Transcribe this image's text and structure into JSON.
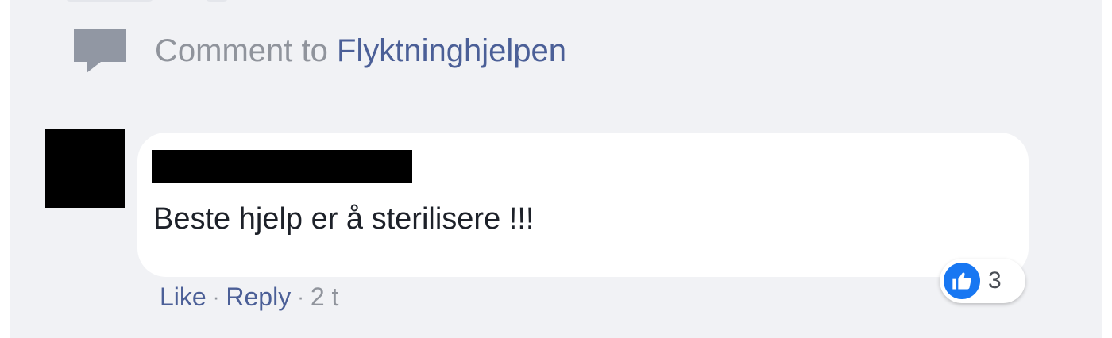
{
  "composer": {
    "prefix": "Comment to ",
    "page_name": "Flyktninghjelpen"
  },
  "comment": {
    "text": "Beste hjelp er å sterilisere !!!",
    "actions": {
      "like_label": "Like",
      "separator": "·",
      "reply_label": "Reply",
      "timestamp": "2 t"
    },
    "reactions": {
      "count": "3",
      "type_icon": "thumbs-up-icon"
    }
  },
  "colors": {
    "background": "#f1f2f5",
    "link": "#4b5f97",
    "muted": "#90949c",
    "like_blue": "#1877f2"
  }
}
